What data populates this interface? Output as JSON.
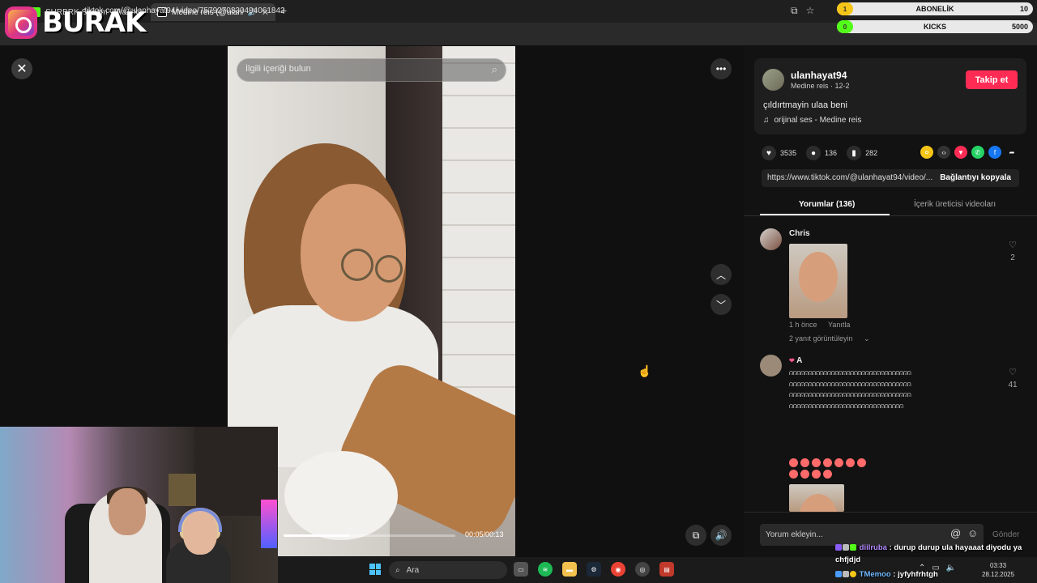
{
  "browser": {
    "tabs": [
      {
        "title": "SHRBRK Stream - Watch Live o",
        "active": false
      },
      {
        "title": "Medine reis (@ulanhayat94",
        "active": false
      }
    ],
    "new_tab": "+",
    "url": "tiktok.com/@ulanhayat94/video/7579270330494061842"
  },
  "overlay": {
    "brand": "BURAK",
    "subscription_label": "ABONELİK",
    "subscription_count": "10",
    "subscription_badge": "1",
    "kicks_label": "KICKS",
    "kicks_count": "5000",
    "kicks_badge": "0"
  },
  "video": {
    "search_placeholder": "İlgili içeriği bulun",
    "time": "00:05/00:13",
    "progress": 0.38
  },
  "post": {
    "author": "ulanhayat94",
    "author_meta": "Medine reis · 12-2",
    "follow_label": "Takip et",
    "caption": "çıldırtmayin ulaa beni",
    "music": "orijinal ses - Medine reis",
    "likes": "3535",
    "comments": "136",
    "saves": "282",
    "link": "https://www.tiktok.com/@ulanhayat94/video/...",
    "copy_label": "Bağlantıyı kopyala"
  },
  "tabs": {
    "comments": "Yorumlar (136)",
    "creator_videos": "İçerik üreticisi videoları"
  },
  "comments": [
    {
      "name": "Chris",
      "time": "1 h önce",
      "reply": "Yanıtla",
      "view_replies": "2 yanıt görüntüleyin",
      "likes": "2"
    },
    {
      "name": "A",
      "likes": "41",
      "text": "ᕬᕬᕬᕬᕬᕬᕬᕬᕬᕬᕬᕬᕬᕬᕬᕬᕬᕬᕬᕬᕬᕬᕬᕬᕬᕬᕬᕬᕬᕬᕬᕬᕬᕬᕬᕬᕬᕬᕬᕬᕬᕬᕬᕬᕬᕬᕬᕬᕬᕬᕬᕬᕬᕬᕬᕬᕬᕬᕬᕬᕬᕬᕬᕬᕬᕬᕬᕬᕬᕬᕬᕬᕬᕬᕬᕬᕬᕬᕬᕬᕬᕬᕬᕬᕬᕬᕬᕬᕬᕬᕬᕬᕬᕬᕬᕬᕬᕬᕬᕬᕬᕬᕬᕬᕬᕬᕬᕬᕬᕬᕬᕬᕬᕬᕬᕬᕬᕬᕬᕬᕬᕬᕬᕬᕬᕬ"
    }
  ],
  "comment_input": {
    "placeholder": "Yorum ekleyin...",
    "send_label": "Gönder"
  },
  "taskbar": {
    "search_label": "Ara",
    "time": "03:33",
    "date": "28.12.2025"
  },
  "chat": [
    {
      "user": "diilruba",
      "message": ": durup durup ula hayaaat diyodu ya chfjdjd"
    },
    {
      "user": "TMemoo",
      "message": ": jyfyhfrhtgh"
    }
  ]
}
